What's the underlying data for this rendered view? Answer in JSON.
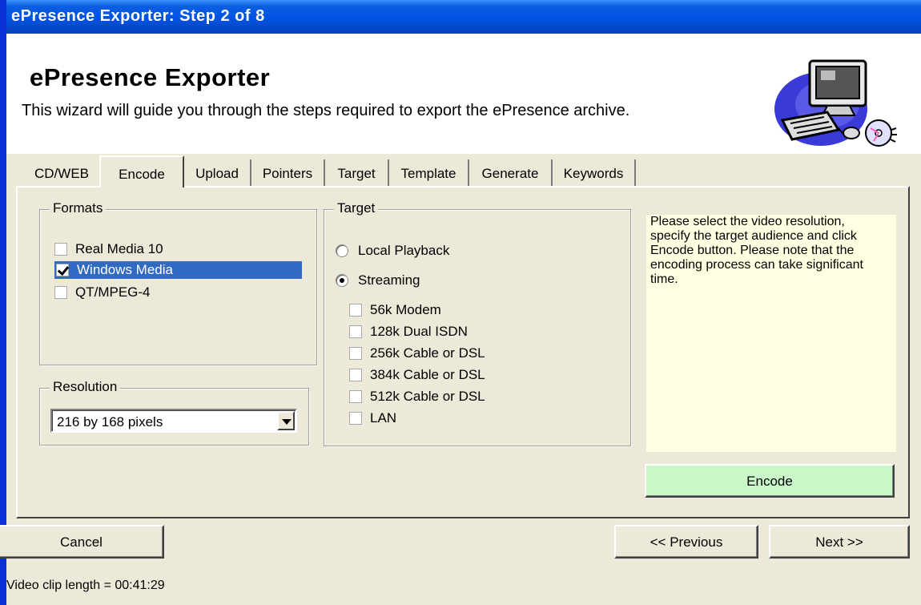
{
  "window": {
    "title": "ePresence Exporter: Step 2 of 8"
  },
  "header": {
    "title": "ePresence Exporter",
    "description": "This wizard will guide you through the steps required to export the ePresence archive.",
    "logo_icon": "computer-cd-icon"
  },
  "tabs": [
    {
      "label": "CD/WEB",
      "active": false
    },
    {
      "label": "Encode",
      "active": true
    },
    {
      "label": "Upload",
      "active": false
    },
    {
      "label": "Pointers",
      "active": false
    },
    {
      "label": "Target",
      "active": false
    },
    {
      "label": "Template",
      "active": false
    },
    {
      "label": "Generate",
      "active": false
    },
    {
      "label": "Keywords",
      "active": false
    }
  ],
  "formats": {
    "legend": "Formats",
    "items": [
      {
        "label": "Real Media 10",
        "checked": false,
        "selected": false
      },
      {
        "label": "Windows Media",
        "checked": true,
        "selected": true
      },
      {
        "label": "QT/MPEG-4",
        "checked": false,
        "selected": false
      }
    ]
  },
  "resolution": {
    "legend": "Resolution",
    "value": "216 by 168 pixels"
  },
  "target": {
    "legend": "Target",
    "radios": [
      {
        "label": "Local Playback",
        "checked": false
      },
      {
        "label": "Streaming",
        "checked": true
      }
    ],
    "bandwidths": [
      {
        "label": "56k Modem",
        "checked": false
      },
      {
        "label": "128k Dual ISDN",
        "checked": false
      },
      {
        "label": "256k Cable or DSL",
        "checked": false
      },
      {
        "label": "384k Cable or DSL",
        "checked": false
      },
      {
        "label": "512k Cable or DSL",
        "checked": false
      },
      {
        "label": "LAN",
        "checked": false
      }
    ]
  },
  "help": {
    "text": "Please select the video resolution, specify the target audience and click Encode button. Please note that the encoding process can take significant time."
  },
  "buttons": {
    "encode": "Encode",
    "cancel": "Cancel",
    "previous": "<< Previous",
    "next": "Next >>"
  },
  "status": {
    "text": "Video clip length = 00:41:29"
  },
  "colors": {
    "titlebar": "#0053e3",
    "selection": "#316ac5",
    "help_background": "#ffffe1",
    "encode_button": "#c9f9c9"
  }
}
